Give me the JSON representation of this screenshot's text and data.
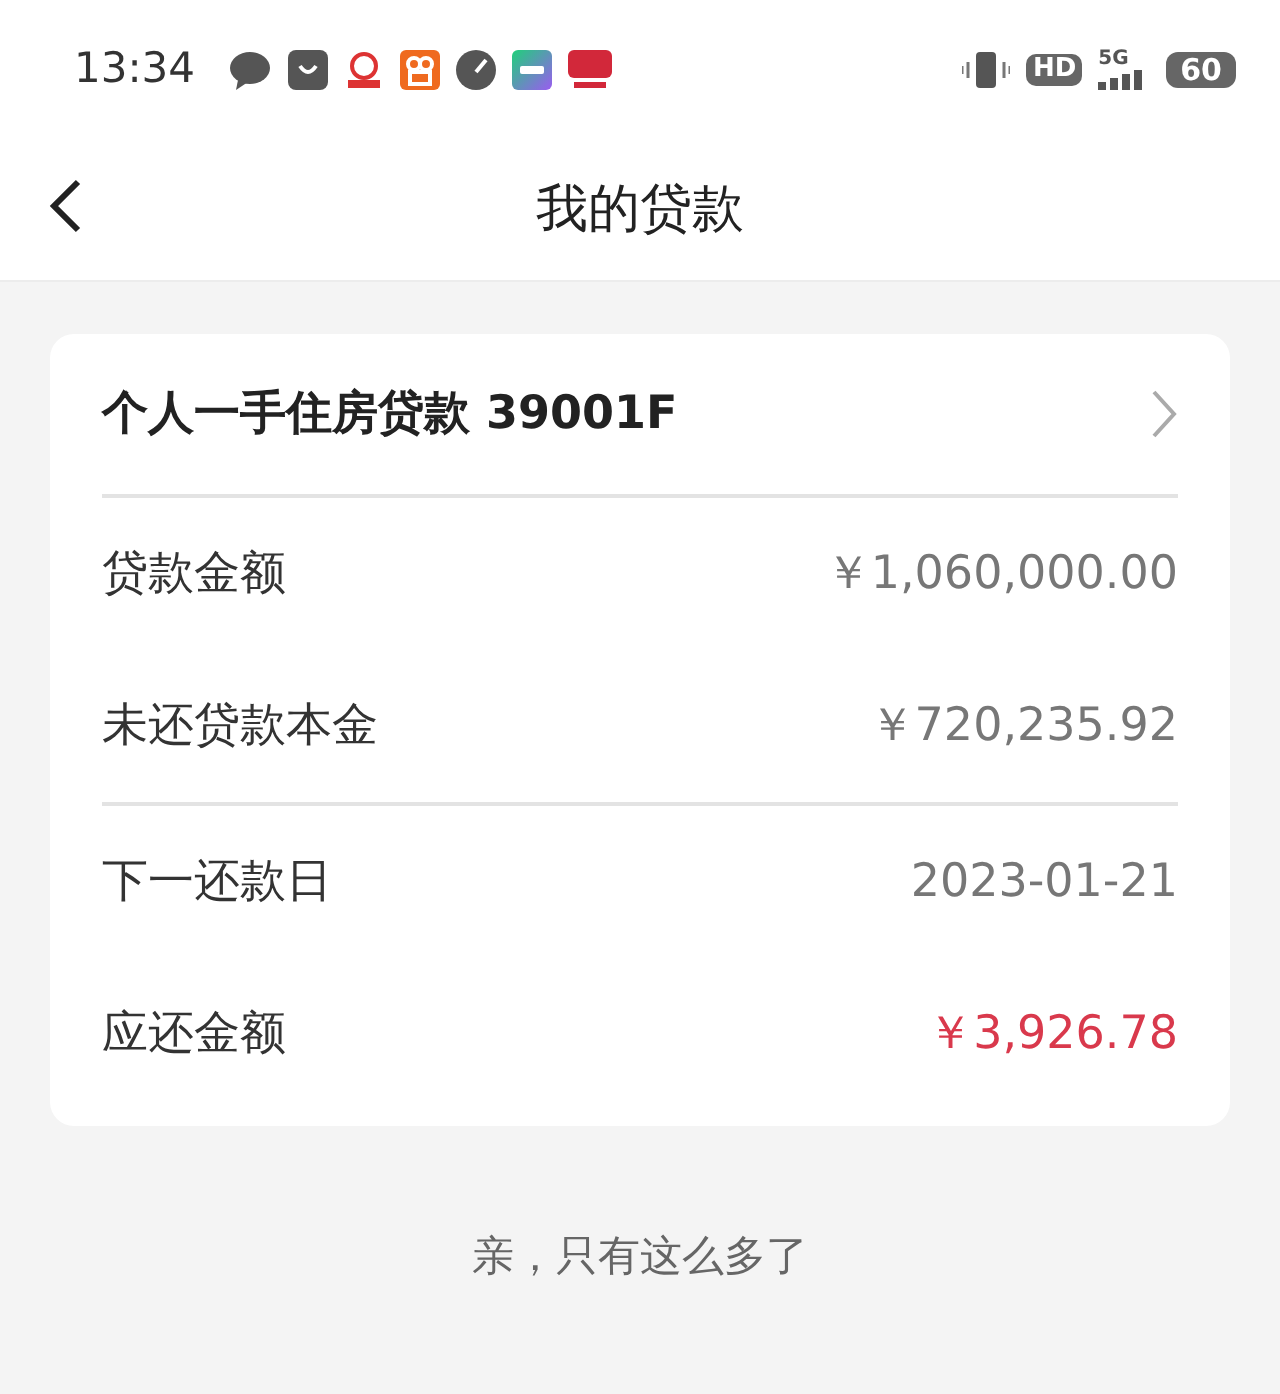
{
  "status_bar": {
    "time": "13:34",
    "hd": "HD",
    "network": "5G",
    "battery": "60"
  },
  "header": {
    "title": "我的贷款"
  },
  "loan": {
    "title": "个人一手住房贷款 39001F",
    "groups": [
      [
        {
          "label": "贷款金额",
          "value": "￥1,060,000.00",
          "kind": "plain"
        },
        {
          "label": "未还贷款本金",
          "value": "￥720,235.92",
          "kind": "plain"
        }
      ],
      [
        {
          "label": "下一还款日",
          "value": "2023-01-21",
          "kind": "plain"
        },
        {
          "label": "应还金额",
          "value": "￥3,926.78",
          "kind": "due"
        }
      ]
    ]
  },
  "footer": "亲，只有这么多了"
}
